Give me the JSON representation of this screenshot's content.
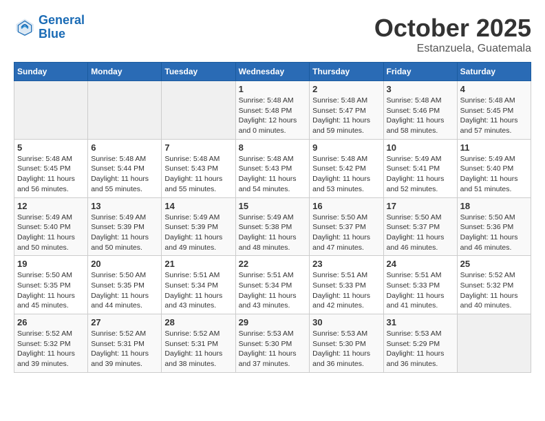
{
  "header": {
    "logo_line1": "General",
    "logo_line2": "Blue",
    "month": "October 2025",
    "location": "Estanzuela, Guatemala"
  },
  "weekdays": [
    "Sunday",
    "Monday",
    "Tuesday",
    "Wednesday",
    "Thursday",
    "Friday",
    "Saturday"
  ],
  "weeks": [
    [
      {
        "day": "",
        "info": ""
      },
      {
        "day": "",
        "info": ""
      },
      {
        "day": "",
        "info": ""
      },
      {
        "day": "1",
        "info": "Sunrise: 5:48 AM\nSunset: 5:48 PM\nDaylight: 12 hours\nand 0 minutes."
      },
      {
        "day": "2",
        "info": "Sunrise: 5:48 AM\nSunset: 5:47 PM\nDaylight: 11 hours\nand 59 minutes."
      },
      {
        "day": "3",
        "info": "Sunrise: 5:48 AM\nSunset: 5:46 PM\nDaylight: 11 hours\nand 58 minutes."
      },
      {
        "day": "4",
        "info": "Sunrise: 5:48 AM\nSunset: 5:45 PM\nDaylight: 11 hours\nand 57 minutes."
      }
    ],
    [
      {
        "day": "5",
        "info": "Sunrise: 5:48 AM\nSunset: 5:45 PM\nDaylight: 11 hours\nand 56 minutes."
      },
      {
        "day": "6",
        "info": "Sunrise: 5:48 AM\nSunset: 5:44 PM\nDaylight: 11 hours\nand 55 minutes."
      },
      {
        "day": "7",
        "info": "Sunrise: 5:48 AM\nSunset: 5:43 PM\nDaylight: 11 hours\nand 55 minutes."
      },
      {
        "day": "8",
        "info": "Sunrise: 5:48 AM\nSunset: 5:43 PM\nDaylight: 11 hours\nand 54 minutes."
      },
      {
        "day": "9",
        "info": "Sunrise: 5:48 AM\nSunset: 5:42 PM\nDaylight: 11 hours\nand 53 minutes."
      },
      {
        "day": "10",
        "info": "Sunrise: 5:49 AM\nSunset: 5:41 PM\nDaylight: 11 hours\nand 52 minutes."
      },
      {
        "day": "11",
        "info": "Sunrise: 5:49 AM\nSunset: 5:40 PM\nDaylight: 11 hours\nand 51 minutes."
      }
    ],
    [
      {
        "day": "12",
        "info": "Sunrise: 5:49 AM\nSunset: 5:40 PM\nDaylight: 11 hours\nand 50 minutes."
      },
      {
        "day": "13",
        "info": "Sunrise: 5:49 AM\nSunset: 5:39 PM\nDaylight: 11 hours\nand 50 minutes."
      },
      {
        "day": "14",
        "info": "Sunrise: 5:49 AM\nSunset: 5:39 PM\nDaylight: 11 hours\nand 49 minutes."
      },
      {
        "day": "15",
        "info": "Sunrise: 5:49 AM\nSunset: 5:38 PM\nDaylight: 11 hours\nand 48 minutes."
      },
      {
        "day": "16",
        "info": "Sunrise: 5:50 AM\nSunset: 5:37 PM\nDaylight: 11 hours\nand 47 minutes."
      },
      {
        "day": "17",
        "info": "Sunrise: 5:50 AM\nSunset: 5:37 PM\nDaylight: 11 hours\nand 46 minutes."
      },
      {
        "day": "18",
        "info": "Sunrise: 5:50 AM\nSunset: 5:36 PM\nDaylight: 11 hours\nand 46 minutes."
      }
    ],
    [
      {
        "day": "19",
        "info": "Sunrise: 5:50 AM\nSunset: 5:35 PM\nDaylight: 11 hours\nand 45 minutes."
      },
      {
        "day": "20",
        "info": "Sunrise: 5:50 AM\nSunset: 5:35 PM\nDaylight: 11 hours\nand 44 minutes."
      },
      {
        "day": "21",
        "info": "Sunrise: 5:51 AM\nSunset: 5:34 PM\nDaylight: 11 hours\nand 43 minutes."
      },
      {
        "day": "22",
        "info": "Sunrise: 5:51 AM\nSunset: 5:34 PM\nDaylight: 11 hours\nand 43 minutes."
      },
      {
        "day": "23",
        "info": "Sunrise: 5:51 AM\nSunset: 5:33 PM\nDaylight: 11 hours\nand 42 minutes."
      },
      {
        "day": "24",
        "info": "Sunrise: 5:51 AM\nSunset: 5:33 PM\nDaylight: 11 hours\nand 41 minutes."
      },
      {
        "day": "25",
        "info": "Sunrise: 5:52 AM\nSunset: 5:32 PM\nDaylight: 11 hours\nand 40 minutes."
      }
    ],
    [
      {
        "day": "26",
        "info": "Sunrise: 5:52 AM\nSunset: 5:32 PM\nDaylight: 11 hours\nand 39 minutes."
      },
      {
        "day": "27",
        "info": "Sunrise: 5:52 AM\nSunset: 5:31 PM\nDaylight: 11 hours\nand 39 minutes."
      },
      {
        "day": "28",
        "info": "Sunrise: 5:52 AM\nSunset: 5:31 PM\nDaylight: 11 hours\nand 38 minutes."
      },
      {
        "day": "29",
        "info": "Sunrise: 5:53 AM\nSunset: 5:30 PM\nDaylight: 11 hours\nand 37 minutes."
      },
      {
        "day": "30",
        "info": "Sunrise: 5:53 AM\nSunset: 5:30 PM\nDaylight: 11 hours\nand 36 minutes."
      },
      {
        "day": "31",
        "info": "Sunrise: 5:53 AM\nSunset: 5:29 PM\nDaylight: 11 hours\nand 36 minutes."
      },
      {
        "day": "",
        "info": ""
      }
    ]
  ]
}
